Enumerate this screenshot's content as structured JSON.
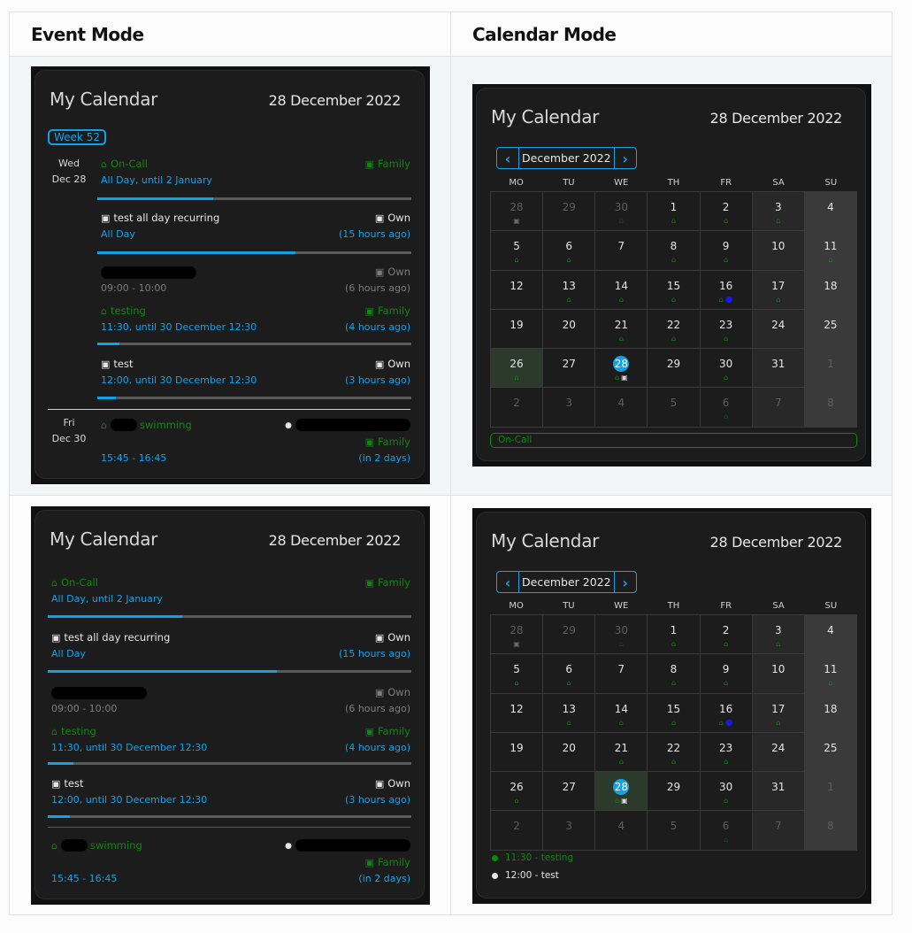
{
  "headers": {
    "event_mode": "Event Mode",
    "calendar_mode": "Calendar Mode"
  },
  "card": {
    "title": "My Calendar",
    "date": "28 December 2022"
  },
  "colors": {
    "accent": "#10a2e8",
    "family": "#0a8a0a",
    "today_blue": "#10a2e8",
    "bg": "#1c1c1c"
  },
  "event_mode_weeks": {
    "week_badge": "Week 52",
    "days": [
      {
        "weekday": "Wed",
        "date": "Dec 28"
      },
      {
        "weekday": "Fri",
        "date": "Dec 30"
      }
    ]
  },
  "events": [
    {
      "icon": "home-icon",
      "title": "On-Call",
      "calendar_icon": "calendar-icon",
      "calendar": "Family",
      "time": "All Day, until 2 January",
      "relative": "",
      "progress": 0.37,
      "color": "green"
    },
    {
      "icon": "image-icon",
      "title": "test all day recurring",
      "calendar_icon": "calendar-icon",
      "calendar": "Own",
      "time": "All Day",
      "relative": "(15 hours ago)",
      "progress": 0.63,
      "color": "white"
    },
    {
      "icon": "",
      "title": "[redacted]",
      "calendar_icon": "calendar-icon",
      "calendar": "Own",
      "time": "09:00 - 10:00",
      "relative": "(6 hours ago)",
      "progress": null,
      "color": "dim"
    },
    {
      "icon": "home-icon",
      "title": "testing",
      "calendar_icon": "calendar-icon",
      "calendar": "Family",
      "time": "11:30, until 30 December 12:30",
      "relative": "(4 hours ago)",
      "progress": 0.07,
      "color": "green"
    },
    {
      "icon": "image-icon",
      "title": "test",
      "calendar_icon": "calendar-icon",
      "calendar": "Own",
      "time": "12:00, until 30 December 12:30",
      "relative": "(3 hours ago)",
      "progress": 0.06,
      "color": "white"
    },
    {
      "icon": "home-icon",
      "title": "swimming",
      "location_icon": "map-marker-icon",
      "location": "[redacted]",
      "calendar_icon": "calendar-icon",
      "calendar": "Family",
      "time": "15:45 - 16:45",
      "relative": "(in 2 days)",
      "progress": null,
      "color": "green"
    }
  ],
  "calendar_mode": {
    "month_label": "December 2022",
    "prev_label": "‹",
    "next_label": "›",
    "weekdays": [
      "MO",
      "TU",
      "WE",
      "TH",
      "FR",
      "SA",
      "SU"
    ],
    "today": 28,
    "weeks": [
      [
        {
          "d": "28",
          "other": true,
          "m": [
            "test"
          ]
        },
        {
          "d": "29",
          "other": true,
          "m": []
        },
        {
          "d": "30",
          "other": true,
          "m": [
            "home"
          ]
        },
        {
          "d": "1",
          "m": [
            "home"
          ]
        },
        {
          "d": "2",
          "m": [
            "home"
          ]
        },
        {
          "d": "3",
          "m": [
            "home"
          ]
        },
        {
          "d": "4",
          "m": []
        }
      ],
      [
        {
          "d": "5",
          "m": [
            "home"
          ]
        },
        {
          "d": "6",
          "m": [
            "home"
          ]
        },
        {
          "d": "7",
          "m": []
        },
        {
          "d": "8",
          "m": [
            "home"
          ]
        },
        {
          "d": "9",
          "m": [
            "home"
          ]
        },
        {
          "d": "10",
          "m": []
        },
        {
          "d": "11",
          "m": [
            "home"
          ]
        }
      ],
      [
        {
          "d": "12",
          "m": []
        },
        {
          "d": "13",
          "m": [
            "home"
          ]
        },
        {
          "d": "14",
          "m": [
            "home"
          ]
        },
        {
          "d": "15",
          "m": [
            "home"
          ]
        },
        {
          "d": "16",
          "m": [
            "home",
            "dot"
          ]
        },
        {
          "d": "17",
          "m": [
            "home"
          ]
        },
        {
          "d": "18",
          "m": []
        }
      ],
      [
        {
          "d": "19",
          "m": []
        },
        {
          "d": "20",
          "m": []
        },
        {
          "d": "21",
          "m": [
            "home"
          ]
        },
        {
          "d": "22",
          "m": [
            "home"
          ]
        },
        {
          "d": "23",
          "m": [
            "home"
          ]
        },
        {
          "d": "24",
          "m": []
        },
        {
          "d": "25",
          "m": []
        }
      ],
      [
        {
          "d": "26",
          "m": [
            "home"
          ]
        },
        {
          "d": "27",
          "m": []
        },
        {
          "d": "28",
          "today": true,
          "m": [
            "home",
            "test"
          ]
        },
        {
          "d": "29",
          "m": []
        },
        {
          "d": "30",
          "m": [
            "home"
          ]
        },
        {
          "d": "31",
          "m": []
        },
        {
          "d": "1",
          "other": true,
          "m": []
        }
      ],
      [
        {
          "d": "2",
          "other": true,
          "m": []
        },
        {
          "d": "3",
          "other": true,
          "m": []
        },
        {
          "d": "4",
          "other": true,
          "m": []
        },
        {
          "d": "5",
          "other": true,
          "m": []
        },
        {
          "d": "6",
          "other": true,
          "m": [
            "home"
          ]
        },
        {
          "d": "7",
          "other": true,
          "m": []
        },
        {
          "d": "8",
          "other": true,
          "m": []
        }
      ]
    ],
    "selected_top": "26",
    "selected_bottom": "28",
    "selected_events_top": [
      "On-Call"
    ],
    "selected_events_bottom": [
      {
        "text": "11:30 - testing",
        "color": "#0a8a0a"
      },
      {
        "text": "12:00 - test",
        "color": "#e6e6e6"
      }
    ]
  }
}
